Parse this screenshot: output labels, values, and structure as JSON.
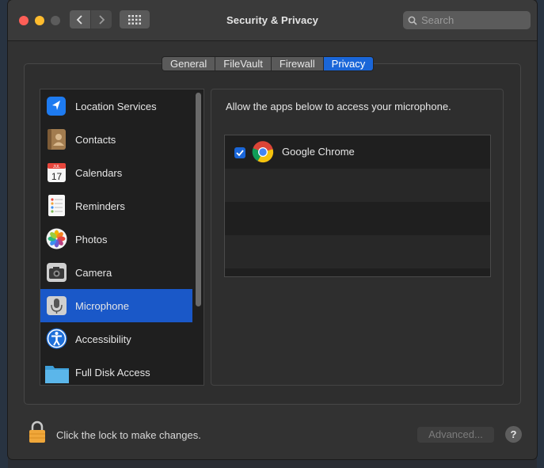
{
  "window": {
    "title": "Security & Privacy"
  },
  "toolbar": {
    "back_icon": "chevron-left-icon",
    "forward_icon": "chevron-right-icon",
    "grid_icon": "grid-icon"
  },
  "search": {
    "placeholder": "Search"
  },
  "tabs": [
    {
      "label": "General",
      "active": false
    },
    {
      "label": "FileVault",
      "active": false
    },
    {
      "label": "Firewall",
      "active": false
    },
    {
      "label": "Privacy",
      "active": true
    }
  ],
  "sidebar": {
    "items": [
      {
        "label": "Location Services",
        "icon": "location-arrow-icon",
        "selected": false
      },
      {
        "label": "Contacts",
        "icon": "contacts-book-icon",
        "selected": false
      },
      {
        "label": "Calendars",
        "icon": "calendar-icon",
        "selected": false,
        "icon_text": "17",
        "icon_month": "JUL"
      },
      {
        "label": "Reminders",
        "icon": "reminders-list-icon",
        "selected": false
      },
      {
        "label": "Photos",
        "icon": "photos-flower-icon",
        "selected": false
      },
      {
        "label": "Camera",
        "icon": "camera-icon",
        "selected": false
      },
      {
        "label": "Microphone",
        "icon": "microphone-icon",
        "selected": true
      },
      {
        "label": "Accessibility",
        "icon": "accessibility-icon",
        "selected": false
      },
      {
        "label": "Full Disk Access",
        "icon": "folder-icon",
        "selected": false
      }
    ]
  },
  "main": {
    "description": "Allow the apps below to access your microphone.",
    "apps": [
      {
        "name": "Google Chrome",
        "icon": "chrome-icon",
        "checked": true
      }
    ]
  },
  "footer": {
    "lock_text": "Click the lock to make changes.",
    "advanced_label": "Advanced...",
    "help_label": "?"
  },
  "colors": {
    "accent": "#1a66d8",
    "selected_row": "#1a58c8"
  }
}
